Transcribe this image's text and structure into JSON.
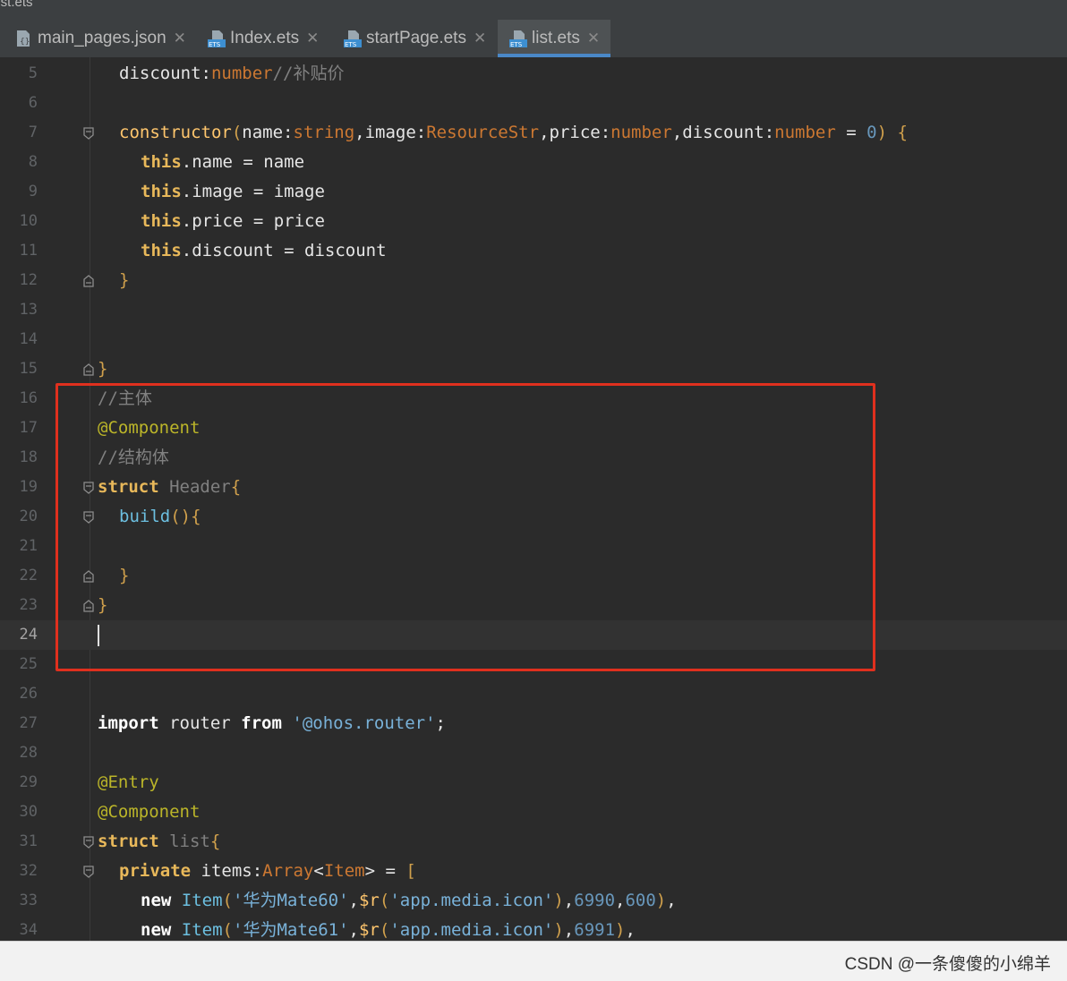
{
  "window": {
    "title": "list.ets"
  },
  "tabs": [
    {
      "label": "main_pages.json",
      "icon": "json-file-icon",
      "active": false
    },
    {
      "label": "Index.ets",
      "icon": "ets-file-icon",
      "active": false
    },
    {
      "label": "startPage.ets",
      "icon": "ets-file-icon",
      "active": false
    },
    {
      "label": "list.ets",
      "icon": "ets-file-icon",
      "active": true
    }
  ],
  "close_glyph": "✕",
  "editor": {
    "current_line": "24",
    "lines": [
      {
        "n": "5",
        "parts": [
          [
            "t-plain",
            "discount"
          ],
          [
            "t-plain",
            ":"
          ],
          [
            "t-type",
            "number"
          ],
          [
            "t-comment",
            "//补贴价"
          ]
        ]
      },
      {
        "n": "6",
        "parts": []
      },
      {
        "n": "7",
        "parts": [
          [
            "t-fn",
            "constructor"
          ],
          [
            "t-paren",
            "("
          ],
          [
            "t-plain",
            "name:"
          ],
          [
            "t-type",
            "string"
          ],
          [
            "t-plain",
            ",image:"
          ],
          [
            "t-type",
            "ResourceStr"
          ],
          [
            "t-plain",
            ",price:"
          ],
          [
            "t-type",
            "number"
          ],
          [
            "t-plain",
            ",discount:"
          ],
          [
            "t-type",
            "number"
          ],
          [
            "t-plain",
            " = "
          ],
          [
            "t-num",
            "0"
          ],
          [
            "t-paren",
            ") {"
          ]
        ]
      },
      {
        "n": "8",
        "parts": [
          [
            "t-kwb",
            "this"
          ],
          [
            "t-plain",
            ".name = name"
          ]
        ]
      },
      {
        "n": "9",
        "parts": [
          [
            "t-kwb",
            "this"
          ],
          [
            "t-plain",
            ".image = image"
          ]
        ]
      },
      {
        "n": "10",
        "parts": [
          [
            "t-kwb",
            "this"
          ],
          [
            "t-plain",
            ".price = price"
          ]
        ]
      },
      {
        "n": "11",
        "parts": [
          [
            "t-kwb",
            "this"
          ],
          [
            "t-plain",
            ".discount = discount"
          ]
        ]
      },
      {
        "n": "12",
        "parts": [
          [
            "t-paren",
            "}"
          ]
        ]
      },
      {
        "n": "13",
        "parts": []
      },
      {
        "n": "14",
        "parts": []
      },
      {
        "n": "15",
        "parts": [
          [
            "t-paren",
            "}"
          ]
        ]
      },
      {
        "n": "16",
        "parts": [
          [
            "t-comment",
            "//主体"
          ]
        ]
      },
      {
        "n": "17",
        "parts": [
          [
            "t-anno",
            "@Component"
          ]
        ]
      },
      {
        "n": "18",
        "parts": [
          [
            "t-comment",
            "//结构体"
          ]
        ]
      },
      {
        "n": "19",
        "parts": [
          [
            "t-kwb",
            "struct"
          ],
          [
            "t-plain",
            " "
          ],
          [
            "t-struct",
            "Header"
          ],
          [
            "t-paren",
            "{"
          ]
        ]
      },
      {
        "n": "20",
        "parts": [
          [
            "t-fnb",
            "build"
          ],
          [
            "t-paren",
            "(){"
          ]
        ]
      },
      {
        "n": "21",
        "parts": []
      },
      {
        "n": "22",
        "parts": [
          [
            "t-paren",
            "}"
          ]
        ]
      },
      {
        "n": "23",
        "parts": [
          [
            "t-paren",
            "}"
          ]
        ]
      },
      {
        "n": "24",
        "parts": []
      },
      {
        "n": "25",
        "parts": []
      },
      {
        "n": "26",
        "parts": []
      },
      {
        "n": "27",
        "parts": [
          [
            "t-new",
            "import"
          ],
          [
            "t-plain",
            " router "
          ],
          [
            "t-new",
            "from"
          ],
          [
            "t-plain",
            " "
          ],
          [
            "t-str2",
            "'@ohos.router'"
          ],
          [
            "t-plain",
            ";"
          ]
        ]
      },
      {
        "n": "28",
        "parts": []
      },
      {
        "n": "29",
        "parts": [
          [
            "t-anno",
            "@Entry"
          ]
        ]
      },
      {
        "n": "30",
        "parts": [
          [
            "t-anno",
            "@Component"
          ]
        ]
      },
      {
        "n": "31",
        "parts": [
          [
            "t-kwb",
            "struct"
          ],
          [
            "t-plain",
            " "
          ],
          [
            "t-struct",
            "list"
          ],
          [
            "t-paren",
            "{"
          ]
        ]
      },
      {
        "n": "32",
        "parts": [
          [
            "t-kwb",
            "private"
          ],
          [
            "t-plain",
            " items:"
          ],
          [
            "t-type",
            "Array"
          ],
          [
            "t-plain",
            "<"
          ],
          [
            "t-type",
            "Item"
          ],
          [
            "t-plain",
            "> = "
          ],
          [
            "t-paren",
            "["
          ]
        ]
      },
      {
        "n": "33",
        "parts": [
          [
            "t-new",
            "new"
          ],
          [
            "t-plain",
            " "
          ],
          [
            "t-cls",
            "Item"
          ],
          [
            "t-paren",
            "("
          ],
          [
            "t-str2",
            "'华为Mate60'"
          ],
          [
            "t-plain",
            ","
          ],
          [
            "t-fn",
            "$r"
          ],
          [
            "t-paren",
            "("
          ],
          [
            "t-str2",
            "'app.media.icon'"
          ],
          [
            "t-paren",
            ")"
          ],
          [
            "t-plain",
            ","
          ],
          [
            "t-num",
            "6990"
          ],
          [
            "t-plain",
            ","
          ],
          [
            "t-num",
            "600"
          ],
          [
            "t-paren",
            ")"
          ],
          [
            "t-plain",
            ","
          ]
        ]
      },
      {
        "n": "34",
        "parts": [
          [
            "t-new",
            "new"
          ],
          [
            "t-plain",
            " "
          ],
          [
            "t-cls",
            "Item"
          ],
          [
            "t-paren",
            "("
          ],
          [
            "t-str2",
            "'华为Mate61'"
          ],
          [
            "t-plain",
            ","
          ],
          [
            "t-fn",
            "$r"
          ],
          [
            "t-paren",
            "("
          ],
          [
            "t-str2",
            "'app.media.icon'"
          ],
          [
            "t-paren",
            ")"
          ],
          [
            "t-plain",
            ","
          ],
          [
            "t-num",
            "6991"
          ],
          [
            "t-paren",
            ")"
          ],
          [
            "t-plain",
            ","
          ]
        ]
      }
    ]
  },
  "watermark": "CSDN @一条傻傻的小绵羊",
  "colors": {
    "highlight_box": "#e0301e",
    "active_tab_underline": "#4a88c7"
  }
}
